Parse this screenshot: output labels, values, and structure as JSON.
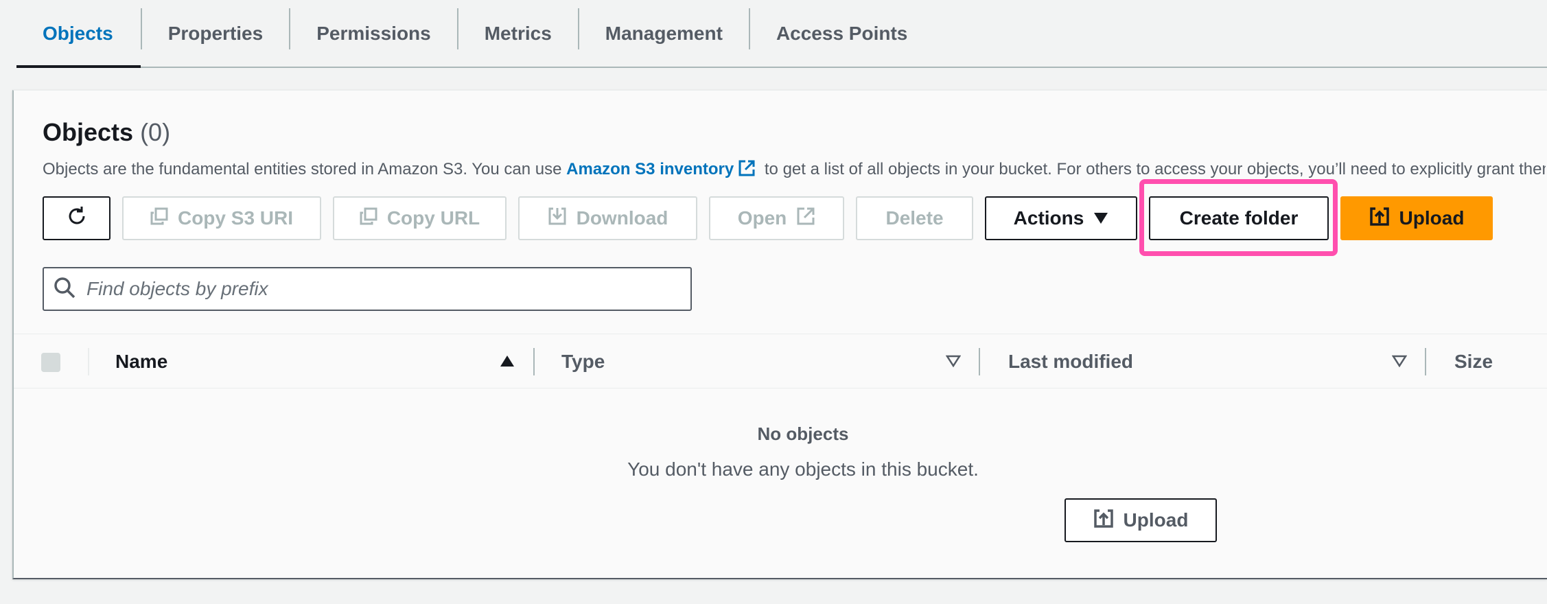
{
  "tabs": [
    {
      "label": "Objects",
      "active": true
    },
    {
      "label": "Properties"
    },
    {
      "label": "Permissions"
    },
    {
      "label": "Metrics"
    },
    {
      "label": "Management"
    },
    {
      "label": "Access Points"
    }
  ],
  "panel": {
    "title": "Objects",
    "count": "(0)",
    "description_before": "Objects are the fundamental entities stored in Amazon S3. You can use",
    "description_link": "Amazon S3 inventory",
    "description_after": "to get a list of all objects in your bucket. For others to access your objects, you’ll need to explicitly grant them permissions."
  },
  "toolbar": {
    "refresh_icon": "refresh-icon",
    "copy_s3_uri": "Copy S3 URI",
    "copy_url": "Copy URL",
    "download": "Download",
    "open": "Open",
    "delete": "Delete",
    "actions": "Actions",
    "create_folder": "Create folder",
    "upload": "Upload"
  },
  "search": {
    "placeholder": "Find objects by prefix",
    "value": ""
  },
  "table": {
    "columns": [
      "Name",
      "Type",
      "Last modified",
      "Size"
    ],
    "rows": []
  },
  "empty_state": {
    "title": "No objects",
    "description": "You don't have any objects in this bucket.",
    "upload_label": "Upload"
  },
  "colors": {
    "accent": "#0073bb",
    "primary_button": "#ff9900",
    "highlight": "#ff4fae",
    "text": "#16191f",
    "muted": "#545b64",
    "disabled": "#aab7b8"
  }
}
